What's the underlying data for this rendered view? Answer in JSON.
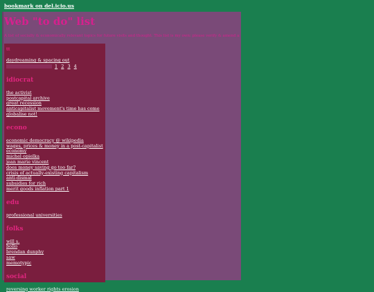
{
  "topbar": {
    "bookmark_label": "bookmark on del.icio.us"
  },
  "header": {
    "title": "Web \"to do\" list",
    "subtitle": "A list of socially & economically relevant topics for future visits and thought. This list is my own: please verify & amend as you see fit."
  },
  "sidebar": {
    "top_section": {
      "title": "tt",
      "links": [
        "daydreaming & spacing out"
      ],
      "pages": [
        "1",
        "2",
        "3",
        "4"
      ]
    },
    "sections": [
      {
        "title": "idiocrat",
        "links": [
          "the activist",
          "postcapital archive",
          "great recession",
          "anticapitalist movement's time has come",
          "globalise not!"
        ]
      },
      {
        "title": "econo",
        "links": [
          "economic democracy @ wikipedia",
          "wages, prices & money in a post-capitalist economy",
          "michel opielka",
          "jean marie vincent",
          "does money saving go too far?",
          "crisis of actually-existing capitalism",
          "anti-dismal",
          "subsidies for rich",
          "merit goods inflation part 1"
        ]
      },
      {
        "title": "edu",
        "links": [
          "professional universities"
        ]
      },
      {
        "title": "folks",
        "links": [
          "will s.",
          "bollo",
          "brendan dunphy",
          "saw",
          "memotypic"
        ]
      },
      {
        "title": "social",
        "links": [
          "reversing worker rights erosion"
        ]
      }
    ]
  }
}
